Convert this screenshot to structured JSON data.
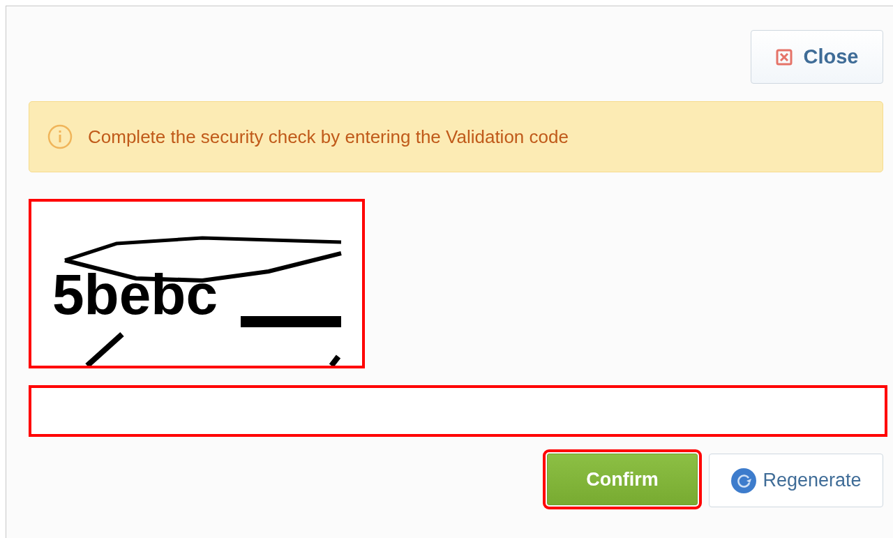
{
  "close_button": {
    "label": "Close"
  },
  "alert": {
    "message": "Complete the security check by entering the Validation code"
  },
  "captcha": {
    "code": "5bebc",
    "highlighted": true
  },
  "code_input": {
    "highlighted": true
  },
  "buttons": [
    {
      "kind": "primary",
      "label": "Confirm",
      "highlighted": true
    },
    {
      "kind": "refresh",
      "label": "Regenerate",
      "highlighted": false
    }
  ]
}
